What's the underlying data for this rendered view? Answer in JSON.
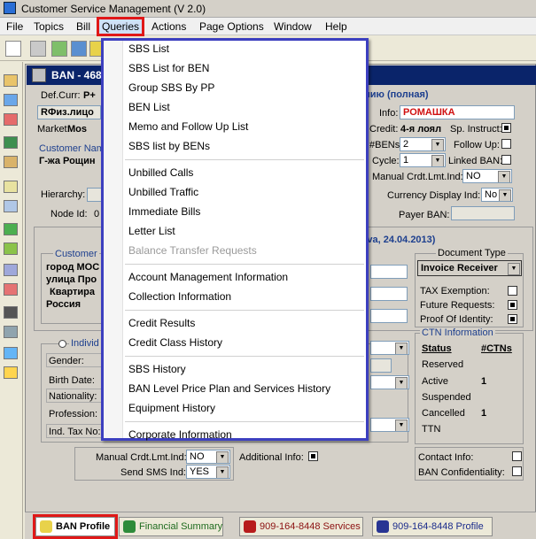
{
  "window": {
    "title": "Customer Service Management  (V 2.0)"
  },
  "menubar": {
    "items": [
      "File",
      "Topics",
      "Bill",
      "Queries",
      "Actions",
      "Page Options",
      "Window",
      "Help"
    ]
  },
  "subwindow": {
    "title": "BAN - 468"
  },
  "header": {
    "def_curr_label": "Def.Curr:",
    "def_curr_value": "P+",
    "type_value": "RФиз.лицо",
    "market_label": "Market:",
    "market_value": "Mos",
    "customer_name_label": "Customer Nam",
    "customer_name_value": "Г-жа Рощин",
    "right_heading": "анию (полная)",
    "info_label": "Info:",
    "info_value": "РОМАШКА",
    "credit_label": "Credit:",
    "credit_value": "4-я лоял",
    "sp_instruct_label": "Sp. Instruct:",
    "bens_label": "#BENs:",
    "bens_value": "2",
    "follow_up_label": "Follow Up:",
    "cycle_label": "Cycle:",
    "cycle_value": "1",
    "linked_ban_label": "Linked BAN:",
    "manual_crdt_label": "Manual Crdt.Lmt.Ind:",
    "manual_crdt_value": "NO",
    "hierarchy_label": "Hierarchy:",
    "currency_ind_label": "Currency Display Ind:",
    "currency_ind_value": "No",
    "node_id_label": "Node Id:",
    "node_id_value": "0",
    "payer_ban_label": "Payer BAN:"
  },
  "address": {
    "heading_right": "tova, 24.04.2013)",
    "customer_label": "Customer",
    "lines": [
      "город МОС",
      "улица Про",
      "Квартира",
      "Россия"
    ]
  },
  "document": {
    "title": "Document Type",
    "value": "Invoice Receiver",
    "tax_exemption_label": "TAX Exemption:",
    "future_requests_label": "Future Requests:",
    "proof_identity_label": "Proof Of Identity:"
  },
  "individual": {
    "title": "Individ",
    "gender_label": "Gender:",
    "birth_date_label": "Birth Date:",
    "nationality_label": "Nationality:",
    "profession_label": "Profession:",
    "tax_no_label": "Ind. Tax No:"
  },
  "ctn": {
    "title": "CTN Information",
    "col_status": "Status",
    "col_ctns": "#CTNs",
    "rows": [
      {
        "status": "Reserved",
        "count": ""
      },
      {
        "status": "Active",
        "count": "1"
      },
      {
        "status": "Suspended",
        "count": ""
      },
      {
        "status": "Cancelled",
        "count": "1"
      },
      {
        "status": "TTN",
        "count": ""
      }
    ]
  },
  "bottom": {
    "manual_crdt_label": "Manual Crdt.Lmt.Ind:",
    "manual_crdt_value": "NO",
    "send_sms_label": "Send SMS Ind:",
    "send_sms_value": "YES",
    "additional_info_label": "Additional Info:",
    "contact_info_label": "Contact Info:",
    "ban_confidentiality_label": "BAN Confidentiality:"
  },
  "queries_menu": {
    "items": [
      {
        "label": "SBS List",
        "disabled": false
      },
      {
        "label": "SBS List for BEN",
        "disabled": false
      },
      {
        "label": "Group SBS By PP",
        "disabled": false
      },
      {
        "label": "BEN List",
        "disabled": false
      },
      {
        "label": "Memo and Follow Up List",
        "disabled": false
      },
      {
        "label": "SBS list by BENs",
        "disabled": false
      },
      {
        "label": "Unbilled Calls",
        "disabled": false
      },
      {
        "label": "Unbilled Traffic",
        "disabled": false
      },
      {
        "label": "Immediate Bills",
        "disabled": false
      },
      {
        "label": "Letter List",
        "disabled": false
      },
      {
        "label": "Balance Transfer Requests",
        "disabled": true
      },
      {
        "label": "Account Management Information",
        "disabled": false
      },
      {
        "label": "Collection Information",
        "disabled": false
      },
      {
        "label": "Credit Results",
        "disabled": false
      },
      {
        "label": "Credit Class History",
        "disabled": false
      },
      {
        "label": "SBS History",
        "disabled": false
      },
      {
        "label": "BAN Level Price Plan and Services History",
        "disabled": false
      },
      {
        "label": "Equipment History",
        "disabled": false
      },
      {
        "label": "Corporate Information",
        "disabled": false
      }
    ]
  },
  "tabs": [
    {
      "label": "BAN Profile",
      "active": true
    },
    {
      "label": "Financial Summary",
      "active": false
    },
    {
      "label": "909-164-8448 Services",
      "active": false
    },
    {
      "label": "909-164-8448 Profile",
      "active": false
    }
  ],
  "colors": {
    "menu_highlight": "#e01818",
    "dropdown_border": "#3c3fbf",
    "heading_blue": "#1d3f8e",
    "info_value_red": "#d01010"
  }
}
